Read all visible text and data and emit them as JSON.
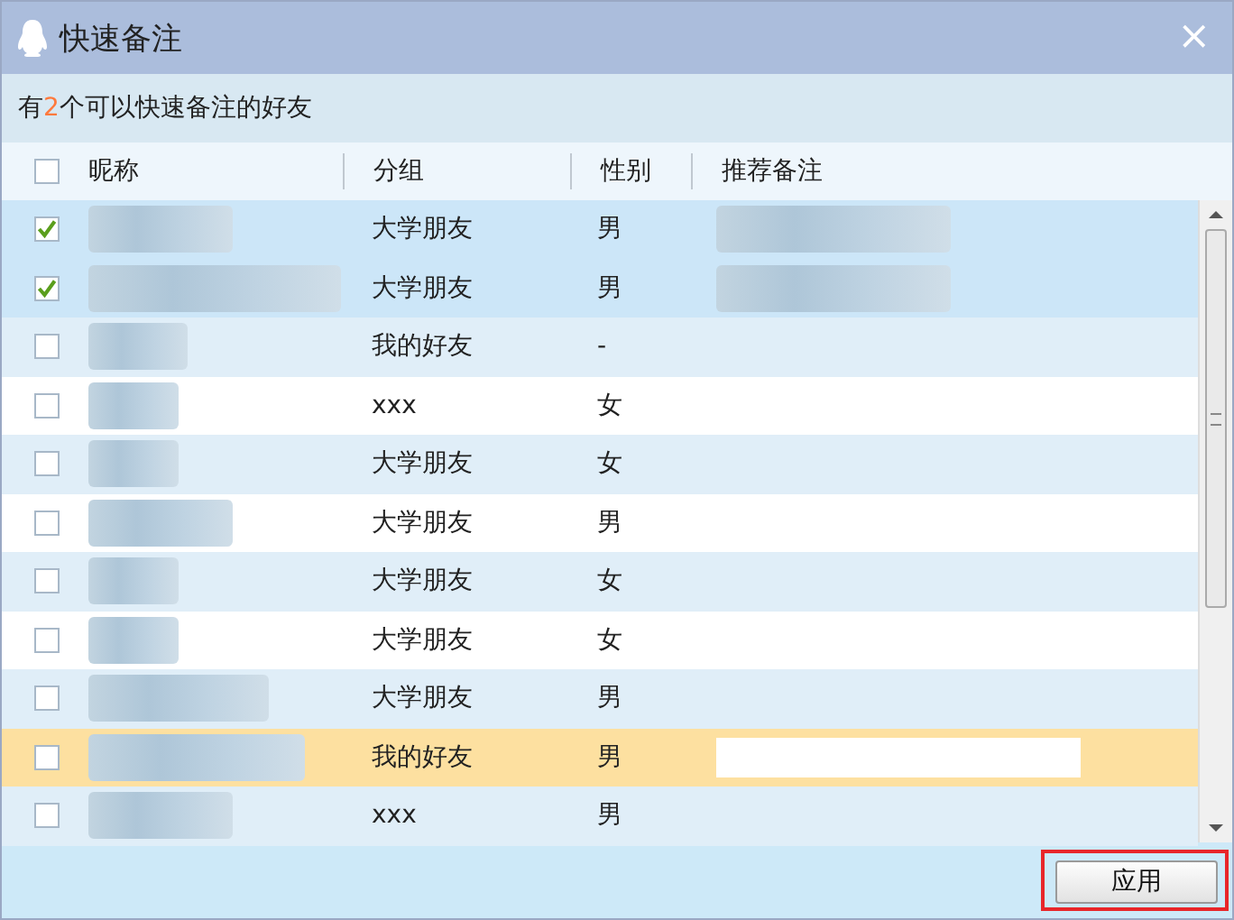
{
  "window": {
    "title": "快速备注",
    "close": "×"
  },
  "summary": "有**2**个可以快速备注的好友",
  "table": {
    "select_all": {
      "checked": false
    },
    "columns": [
      "昵称",
      "分组",
      "性别",
      "推荐备注"
    ],
    "rows": [
      {
        "checked": true,
        "selected": false,
        "group": "大学朋友",
        "gender": "男",
        "remark_blurred": true
      },
      {
        "checked": true,
        "selected": false,
        "group": "大学朋友",
        "gender": "男",
        "remark_blurred": true
      },
      {
        "checked": false,
        "selected": false,
        "group": "我的好友",
        "gender": "-",
        "remark_blurred": false
      },
      {
        "checked": false,
        "selected": false,
        "group": "xxx",
        "gender": "女",
        "remark_blurred": false
      },
      {
        "checked": false,
        "selected": false,
        "group": "大学朋友",
        "gender": "女",
        "remark_blurred": false
      },
      {
        "checked": false,
        "selected": false,
        "group": "大学朋友",
        "gender": "男",
        "remark_blurred": false
      },
      {
        "checked": false,
        "selected": false,
        "group": "大学朋友",
        "gender": "女",
        "remark_blurred": false
      },
      {
        "checked": false,
        "selected": false,
        "group": "大学朋友",
        "gender": "女",
        "remark_blurred": false
      },
      {
        "checked": false,
        "selected": false,
        "group": "大学朋友",
        "gender": "男",
        "remark_blurred": false
      },
      {
        "checked": false,
        "selected": true,
        "group": "我的好友",
        "gender": "男",
        "remark_blurred": false
      },
      {
        "checked": false,
        "selected": false,
        "group": "xxx",
        "gender": "男",
        "remark_blurred": false
      }
    ]
  },
  "buttons": [
    {
      "label": "应用",
      "highlighted": true
    }
  ]
}
